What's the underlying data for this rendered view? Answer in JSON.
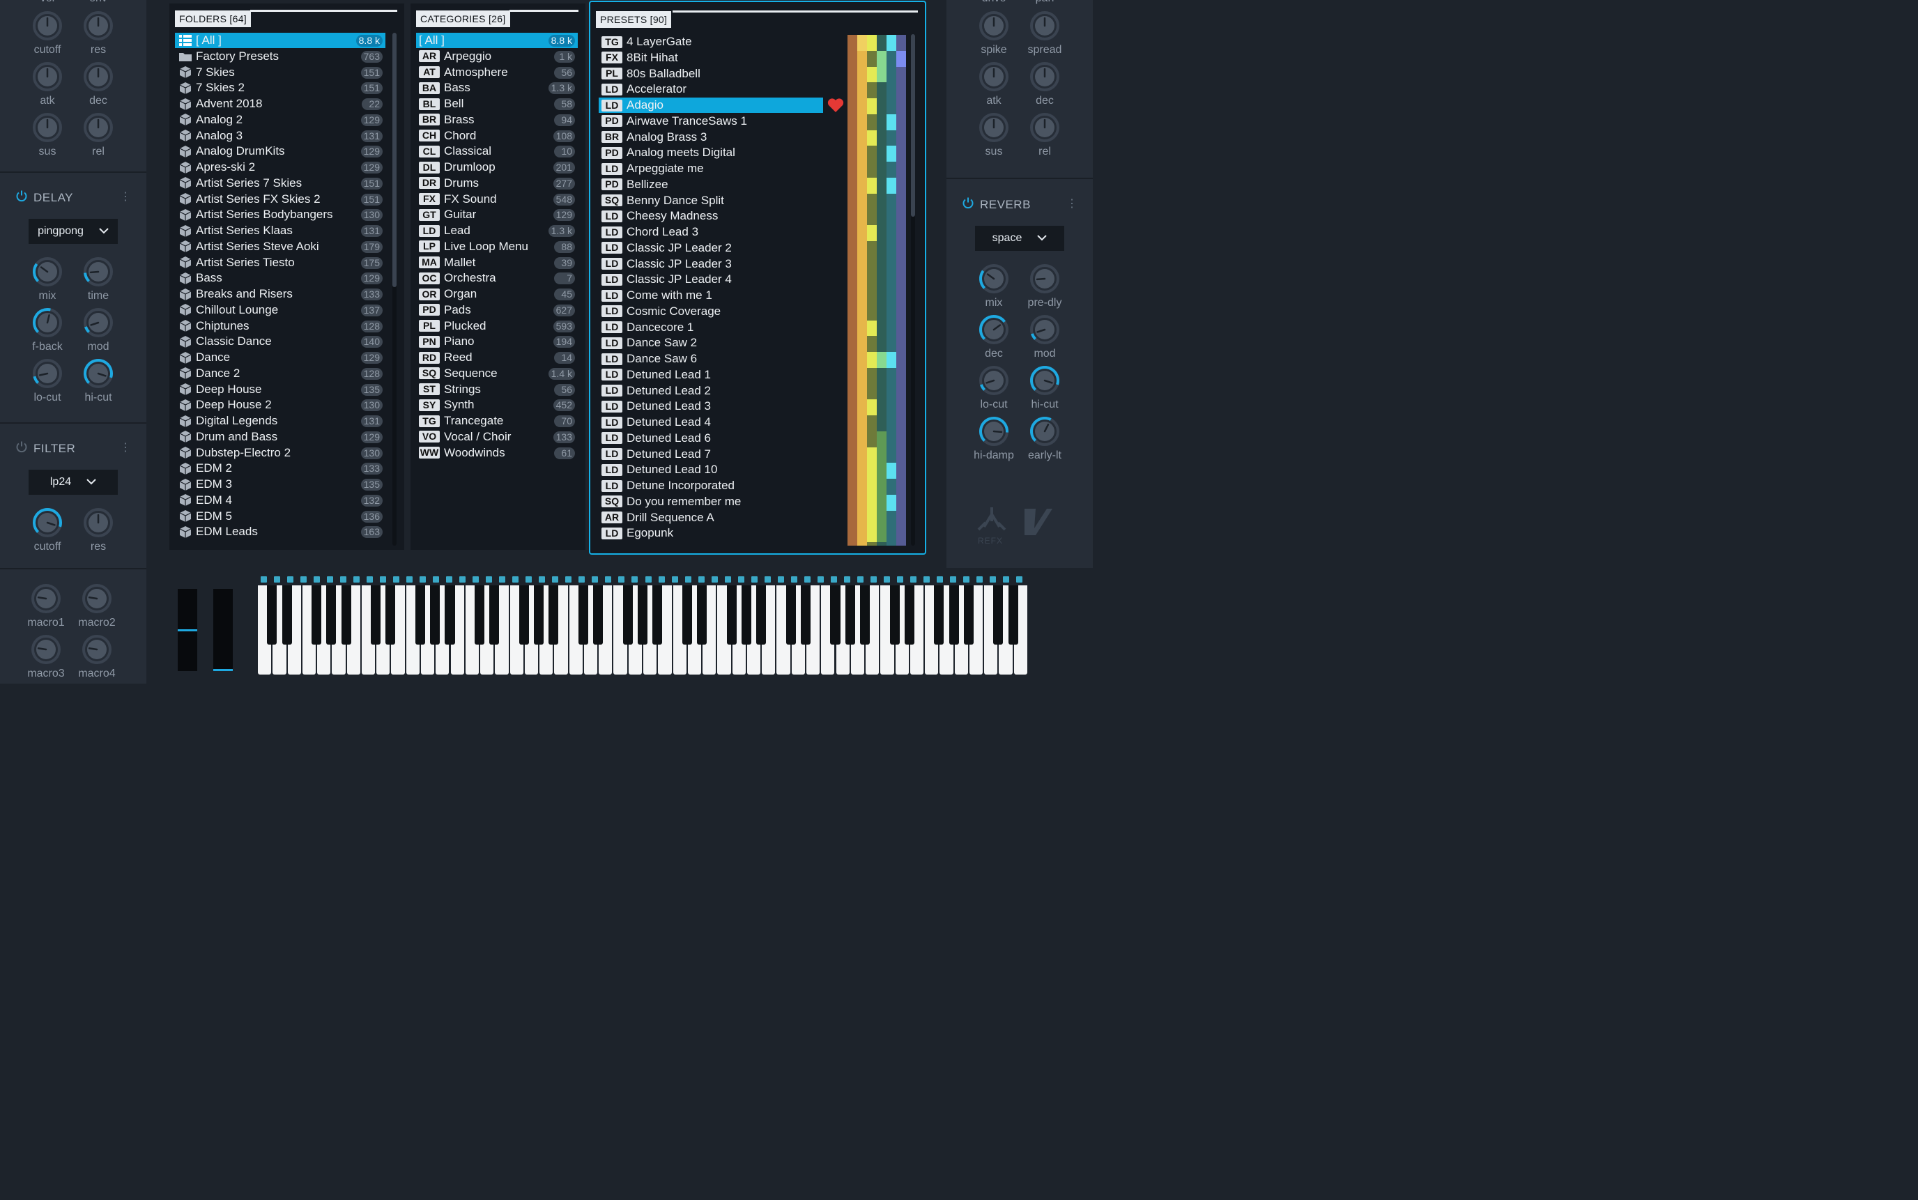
{
  "left_panel": {
    "top_labels": [
      "vel",
      "env"
    ],
    "env1": [
      {
        "label": "cutoff"
      },
      {
        "label": "res"
      },
      {
        "label": "atk"
      },
      {
        "label": "dec"
      },
      {
        "label": "sus"
      },
      {
        "label": "rel"
      }
    ],
    "delay": {
      "title": "DELAY",
      "mode": "pingpong",
      "knobs": [
        {
          "label": "mix"
        },
        {
          "label": "time"
        },
        {
          "label": "f-back"
        },
        {
          "label": "mod"
        },
        {
          "label": "lo-cut"
        },
        {
          "label": "hi-cut"
        }
      ]
    },
    "filter": {
      "title": "FILTER",
      "mode": "lp24",
      "knobs": [
        {
          "label": "cutoff"
        },
        {
          "label": "res"
        }
      ]
    },
    "macros": [
      {
        "label": "macro1"
      },
      {
        "label": "macro2"
      },
      {
        "label": "macro3"
      },
      {
        "label": "macro4"
      }
    ]
  },
  "right_panel": {
    "top_labels": [
      "drive",
      "pan"
    ],
    "env2": [
      {
        "label": "spike"
      },
      {
        "label": "spread"
      },
      {
        "label": "atk"
      },
      {
        "label": "dec"
      },
      {
        "label": "sus"
      },
      {
        "label": "rel"
      }
    ],
    "reverb": {
      "title": "REVERB",
      "mode": "space",
      "knobs": [
        {
          "label": "mix"
        },
        {
          "label": "pre-dly"
        },
        {
          "label": "dec"
        },
        {
          "label": "mod"
        },
        {
          "label": "lo-cut"
        },
        {
          "label": "hi-cut"
        },
        {
          "label": "hi-damp"
        },
        {
          "label": "early-lt"
        }
      ]
    },
    "logos": [
      "REFX",
      "V"
    ]
  },
  "folders": {
    "title": "FOLDERS [64]",
    "items": [
      {
        "name": "[ All ]",
        "count": "8.8 k"
      },
      {
        "name": "Factory Presets",
        "count": "763"
      },
      {
        "name": "7 Skies",
        "count": "151"
      },
      {
        "name": "7 Skies 2",
        "count": "151"
      },
      {
        "name": "Advent 2018",
        "count": "22"
      },
      {
        "name": "Analog 2",
        "count": "129"
      },
      {
        "name": "Analog 3",
        "count": "131"
      },
      {
        "name": "Analog DrumKits",
        "count": "129"
      },
      {
        "name": "Apres-ski 2",
        "count": "129"
      },
      {
        "name": "Artist Series 7 Skies",
        "count": "151"
      },
      {
        "name": "Artist Series FX Skies 2",
        "count": "151"
      },
      {
        "name": "Artist Series Bodybangers",
        "count": "130"
      },
      {
        "name": "Artist Series Klaas",
        "count": "131"
      },
      {
        "name": "Artist Series Steve Aoki",
        "count": "179"
      },
      {
        "name": "Artist Series Tiesto",
        "count": "175"
      },
      {
        "name": "Bass",
        "count": "129"
      },
      {
        "name": "Breaks and Risers",
        "count": "133"
      },
      {
        "name": "Chillout Lounge",
        "count": "137"
      },
      {
        "name": "Chiptunes",
        "count": "128"
      },
      {
        "name": "Classic Dance",
        "count": "140"
      },
      {
        "name": "Dance",
        "count": "129"
      },
      {
        "name": "Dance 2",
        "count": "128"
      },
      {
        "name": "Deep House",
        "count": "135"
      },
      {
        "name": "Deep House 2",
        "count": "130"
      },
      {
        "name": "Digital Legends",
        "count": "131"
      },
      {
        "name": "Drum and Bass",
        "count": "129"
      },
      {
        "name": "Dubstep-Electro 2",
        "count": "130"
      },
      {
        "name": "EDM 2",
        "count": "133"
      },
      {
        "name": "EDM 3",
        "count": "135"
      },
      {
        "name": "EDM 4",
        "count": "132"
      },
      {
        "name": "EDM 5",
        "count": "136"
      },
      {
        "name": "EDM Leads",
        "count": "163"
      }
    ]
  },
  "categories": {
    "title": "CATEGORIES [26]",
    "items": [
      {
        "tag": "",
        "name": "[ All ]",
        "count": "8.8 k"
      },
      {
        "tag": "AR",
        "name": "Arpeggio",
        "count": "1 k"
      },
      {
        "tag": "AT",
        "name": "Atmosphere",
        "count": "56"
      },
      {
        "tag": "BA",
        "name": "Bass",
        "count": "1.3 k"
      },
      {
        "tag": "BL",
        "name": "Bell",
        "count": "58"
      },
      {
        "tag": "BR",
        "name": "Brass",
        "count": "94"
      },
      {
        "tag": "CH",
        "name": "Chord",
        "count": "108"
      },
      {
        "tag": "CL",
        "name": "Classical",
        "count": "10"
      },
      {
        "tag": "DL",
        "name": "Drumloop",
        "count": "201"
      },
      {
        "tag": "DR",
        "name": "Drums",
        "count": "277"
      },
      {
        "tag": "FX",
        "name": "FX Sound",
        "count": "548"
      },
      {
        "tag": "GT",
        "name": "Guitar",
        "count": "129"
      },
      {
        "tag": "LD",
        "name": "Lead",
        "count": "1.3 k"
      },
      {
        "tag": "LP",
        "name": "Live Loop Menu",
        "count": "88"
      },
      {
        "tag": "MA",
        "name": "Mallet",
        "count": "39"
      },
      {
        "tag": "OC",
        "name": "Orchestra",
        "count": "7"
      },
      {
        "tag": "OR",
        "name": "Organ",
        "count": "45"
      },
      {
        "tag": "PD",
        "name": "Pads",
        "count": "627"
      },
      {
        "tag": "PL",
        "name": "Plucked",
        "count": "593"
      },
      {
        "tag": "PN",
        "name": "Piano",
        "count": "194"
      },
      {
        "tag": "RD",
        "name": "Reed",
        "count": "14"
      },
      {
        "tag": "SQ",
        "name": "Sequence",
        "count": "1.4 k"
      },
      {
        "tag": "ST",
        "name": "Strings",
        "count": "56"
      },
      {
        "tag": "SY",
        "name": "Synth",
        "count": "452"
      },
      {
        "tag": "TG",
        "name": "Trancegate",
        "count": "70"
      },
      {
        "tag": "VO",
        "name": "Vocal / Choir",
        "count": "133"
      },
      {
        "tag": "WW",
        "name": "Woodwinds",
        "count": "61"
      }
    ]
  },
  "presets": {
    "title": "PRESETS [90]",
    "selected_index": 4,
    "items": [
      {
        "tag": "TG",
        "name": "4 LayerGate"
      },
      {
        "tag": "FX",
        "name": "8Bit Hihat"
      },
      {
        "tag": "PL",
        "name": "80s Balladbell"
      },
      {
        "tag": "LD",
        "name": "Accelerator"
      },
      {
        "tag": "LD",
        "name": "Adagio",
        "favorite": true
      },
      {
        "tag": "PD",
        "name": "Airwave TranceSaws 1"
      },
      {
        "tag": "BR",
        "name": "Analog Brass 3"
      },
      {
        "tag": "PD",
        "name": "Analog meets Digital"
      },
      {
        "tag": "LD",
        "name": "Arpeggiate me"
      },
      {
        "tag": "PD",
        "name": "Bellizee"
      },
      {
        "tag": "SQ",
        "name": "Benny Dance Split"
      },
      {
        "tag": "LD",
        "name": "Cheesy Madness"
      },
      {
        "tag": "LD",
        "name": "Chord Lead 3"
      },
      {
        "tag": "LD",
        "name": "Classic JP Leader 2"
      },
      {
        "tag": "LD",
        "name": "Classic JP Leader 3"
      },
      {
        "tag": "LD",
        "name": "Classic JP Leader 4"
      },
      {
        "tag": "LD",
        "name": "Come with me 1"
      },
      {
        "tag": "LD",
        "name": "Cosmic Coverage"
      },
      {
        "tag": "LD",
        "name": "Dancecore 1"
      },
      {
        "tag": "LD",
        "name": "Dance Saw 2"
      },
      {
        "tag": "LD",
        "name": "Dance Saw 6"
      },
      {
        "tag": "LD",
        "name": "Detuned Lead 1"
      },
      {
        "tag": "LD",
        "name": "Detuned Lead 2"
      },
      {
        "tag": "LD",
        "name": "Detuned Lead 3"
      },
      {
        "tag": "LD",
        "name": "Detuned Lead 4"
      },
      {
        "tag": "LD",
        "name": "Detuned Lead 6"
      },
      {
        "tag": "LD",
        "name": "Detuned Lead 7"
      },
      {
        "tag": "LD",
        "name": "Detuned Lead 10"
      },
      {
        "tag": "LD",
        "name": "Detune Incorporated"
      },
      {
        "tag": "SQ",
        "name": "Do you remember me"
      },
      {
        "tag": "AR",
        "name": "Drill Sequence A"
      },
      {
        "tag": "LD",
        "name": "Egopunk"
      }
    ]
  },
  "colors": {
    "accent": "#0ea7dc",
    "favorite": "#e53935",
    "panel_bg": "#141920",
    "side_bg": "#262d37"
  },
  "keyboard": {
    "white_keys": 52
  }
}
